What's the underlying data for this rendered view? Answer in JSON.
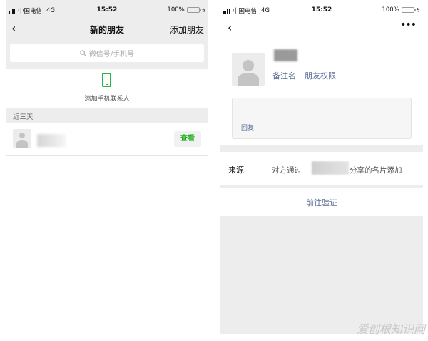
{
  "left": {
    "status": {
      "carrier": "中国电信",
      "network": "4G",
      "time": "15:52",
      "battery": "100%"
    },
    "navbar": {
      "back_icon": "chevron-left-icon",
      "title": "新的朋友",
      "action": "添加朋友"
    },
    "search": {
      "placeholder": "微信号/手机号",
      "icon": "search-icon"
    },
    "add_phone": {
      "icon": "phone-icon",
      "label": "添加手机联系人",
      "color": "#28b34b"
    },
    "section_header": "近三天",
    "friend_request": {
      "button_label": "查看",
      "button_color": "#1aad19"
    }
  },
  "right": {
    "status": {
      "carrier": "中国电信",
      "network": "4G",
      "time": "15:52",
      "battery": "100%"
    },
    "navbar": {
      "back_icon": "chevron-left-icon",
      "more_icon": "more-dots-icon"
    },
    "profile": {
      "remark_link": "备注名",
      "permission_link": "朋友权限",
      "link_color": "#576b95"
    },
    "message": {
      "reply_label": "回复"
    },
    "source": {
      "label": "来源",
      "text_before": "对方通过",
      "text_after": "分享的名片添加"
    },
    "verify_label": "前往验证"
  },
  "watermark": "爱创根知识网"
}
